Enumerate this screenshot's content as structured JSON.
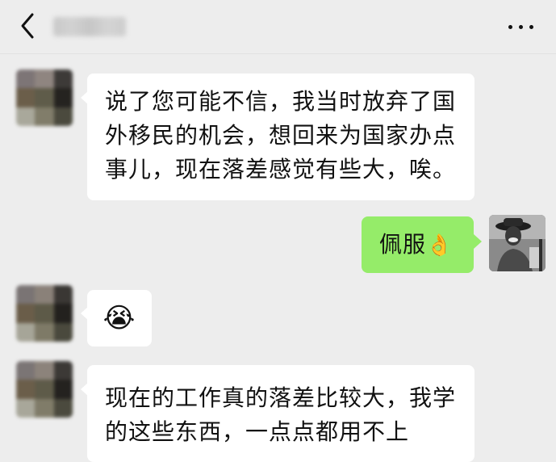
{
  "header": {
    "back_icon": "chevron-left-icon",
    "title": "",
    "more_icon": "ellipsis-icon"
  },
  "messages": [
    {
      "side": "left",
      "lines": [
        "说了您可能不信，我当时放弃了国",
        "外移民的机会，想回来为国家办点",
        "事儿，现在落差感觉有些大，唉。"
      ]
    },
    {
      "side": "right",
      "text": "佩服",
      "emoji": "👌"
    },
    {
      "side": "left",
      "emoji": "😭"
    },
    {
      "side": "left",
      "lines": [
        "现在的工作真的落差比较大，我学",
        "的这些东西，一点点都用不上"
      ]
    }
  ],
  "colors": {
    "background": "#ededed",
    "left_bubble": "#ffffff",
    "right_bubble": "#95ec69"
  }
}
